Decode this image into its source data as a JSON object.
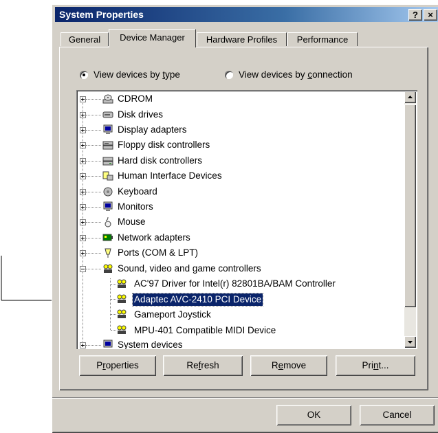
{
  "window": {
    "title": "System Properties",
    "help_label": "?",
    "close_label": "×"
  },
  "tabs": [
    {
      "label": "General",
      "active": false
    },
    {
      "label": "Device Manager",
      "active": true
    },
    {
      "label": "Hardware Profiles",
      "active": false
    },
    {
      "label": "Performance",
      "active": false
    }
  ],
  "view_options": {
    "by_type": {
      "pre": "View devices by ",
      "acc": "t",
      "post": "ype",
      "selected": true
    },
    "by_connection": {
      "pre": "View devices by ",
      "acc": "c",
      "post": "onnection",
      "selected": false
    }
  },
  "tree": {
    "categories": [
      {
        "label": "CDROM",
        "icon": "cdrom-icon",
        "expanded": false
      },
      {
        "label": "Disk drives",
        "icon": "disk-drive-icon",
        "expanded": false
      },
      {
        "label": "Display adapters",
        "icon": "display-adapter-icon",
        "expanded": false
      },
      {
        "label": "Floppy disk controllers",
        "icon": "floppy-controller-icon",
        "expanded": false
      },
      {
        "label": "Hard disk controllers",
        "icon": "hard-disk-controller-icon",
        "expanded": false
      },
      {
        "label": "Human Interface Devices",
        "icon": "hid-icon",
        "expanded": false
      },
      {
        "label": "Keyboard",
        "icon": "keyboard-icon",
        "expanded": false
      },
      {
        "label": "Monitors",
        "icon": "monitor-icon",
        "expanded": false
      },
      {
        "label": "Mouse",
        "icon": "mouse-icon",
        "expanded": false
      },
      {
        "label": "Network adapters",
        "icon": "network-adapter-icon",
        "expanded": false
      },
      {
        "label": "Ports (COM & LPT)",
        "icon": "port-icon",
        "expanded": false
      },
      {
        "label": "Sound, video and game controllers",
        "icon": "sound-controller-icon",
        "expanded": true
      },
      {
        "label": "System devices",
        "icon": "system-device-icon",
        "expanded": false
      }
    ],
    "sound_children": [
      {
        "label": "AC'97 Driver for Intel(r) 82801BA/BAM Controller",
        "selected": false
      },
      {
        "label": "Adaptec AVC-2410 PCI Device",
        "selected": true
      },
      {
        "label": "Gameport Joystick",
        "selected": false
      },
      {
        "label": "MPU-401 Compatible MIDI Device",
        "selected": false
      }
    ]
  },
  "buttons": {
    "properties": {
      "pre": "P",
      "acc": "r",
      "post": "operties"
    },
    "refresh": {
      "pre": "Re",
      "acc": "f",
      "post": "resh"
    },
    "remove": {
      "pre": "R",
      "acc": "e",
      "post": "move"
    },
    "print": {
      "pre": "Pri",
      "acc": "n",
      "post": "t..."
    },
    "ok": "OK",
    "cancel": "Cancel"
  },
  "colors": {
    "face": "#d4d0c8",
    "title_start": "#0a246a",
    "title_end": "#a6caf0",
    "selection": "#0a246a"
  }
}
